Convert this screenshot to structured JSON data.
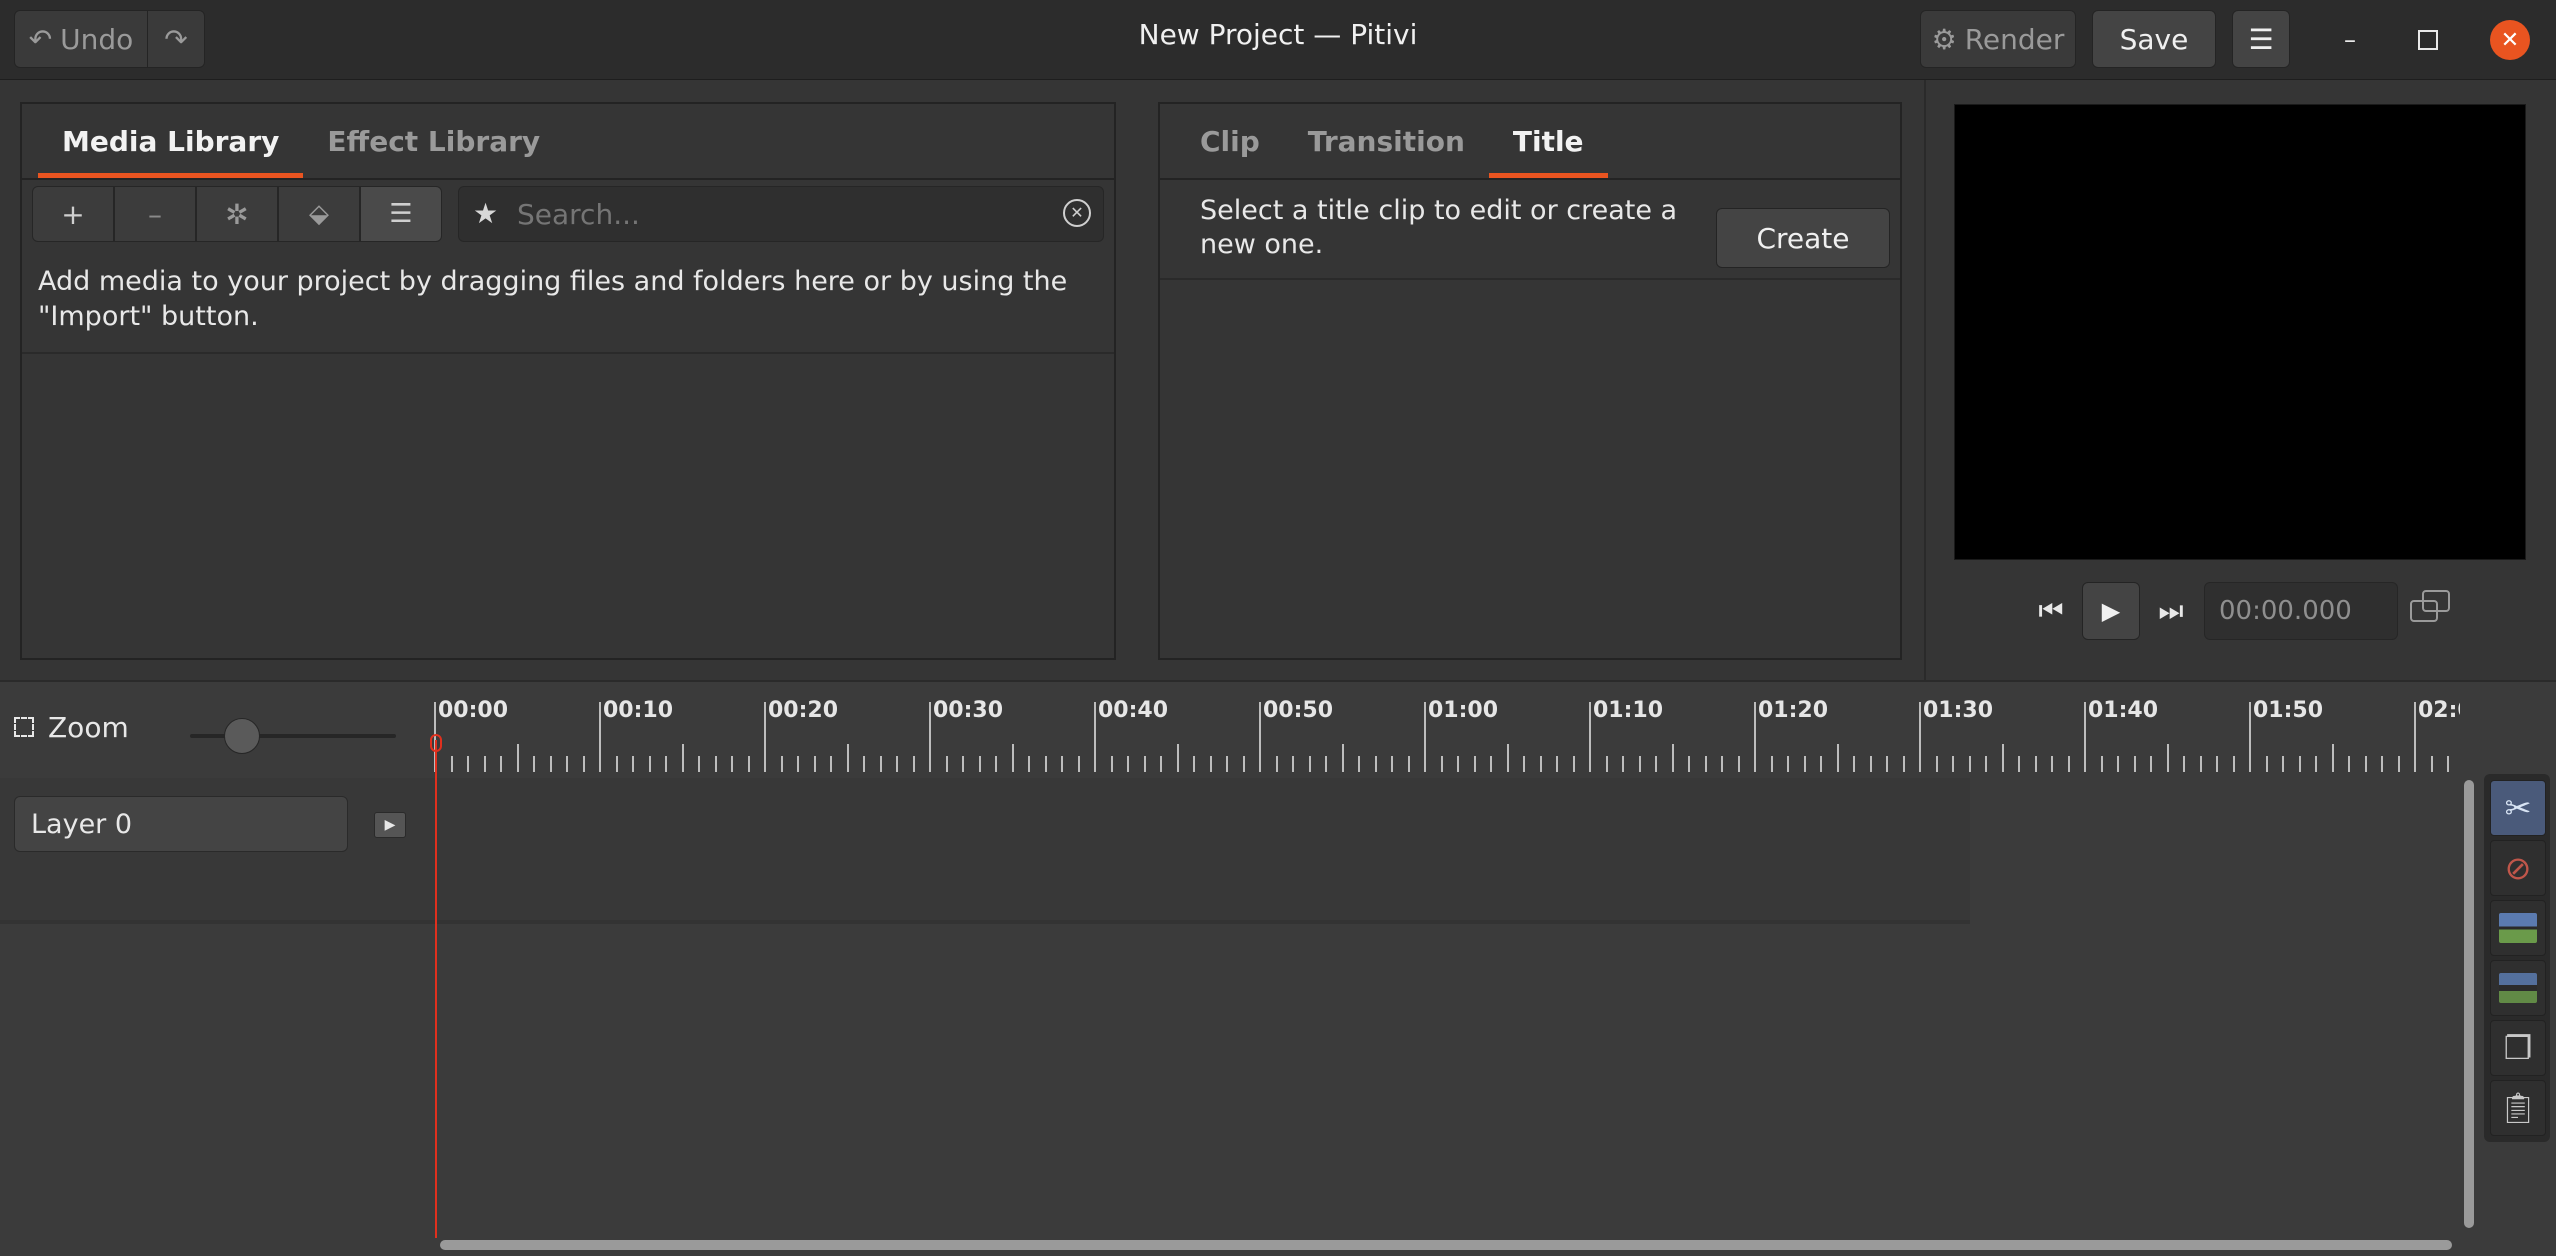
{
  "window": {
    "title": "New Project — Pitivi"
  },
  "headerbar": {
    "undo_label": "Undo",
    "render_label": "Render",
    "save_label": "Save"
  },
  "media_panel": {
    "tabs": [
      "Media Library",
      "Effect Library"
    ],
    "search_placeholder": "Search...",
    "hint": "Add media to your project by dragging files and folders here or by using the \"Import\" button."
  },
  "clip_panel": {
    "tabs": [
      "Clip",
      "Transition",
      "Title"
    ],
    "hint": "Select a title clip to edit or create a new one.",
    "create_label": "Create"
  },
  "viewer": {
    "timecode": "00:00.000"
  },
  "timeline": {
    "zoom_label": "Zoom",
    "zoom_level": 0.2,
    "ruler_labels": [
      "00:00",
      "00:10",
      "00:20",
      "00:30",
      "00:40",
      "00:50",
      "01:00",
      "01:10",
      "01:20",
      "01:30",
      "01:40",
      "01:50",
      "02:0"
    ],
    "layers": [
      {
        "name": "Layer 0"
      }
    ]
  },
  "colors": {
    "accent": "#e95420",
    "playhead": "#e0301e",
    "close_button": "#e95420"
  }
}
